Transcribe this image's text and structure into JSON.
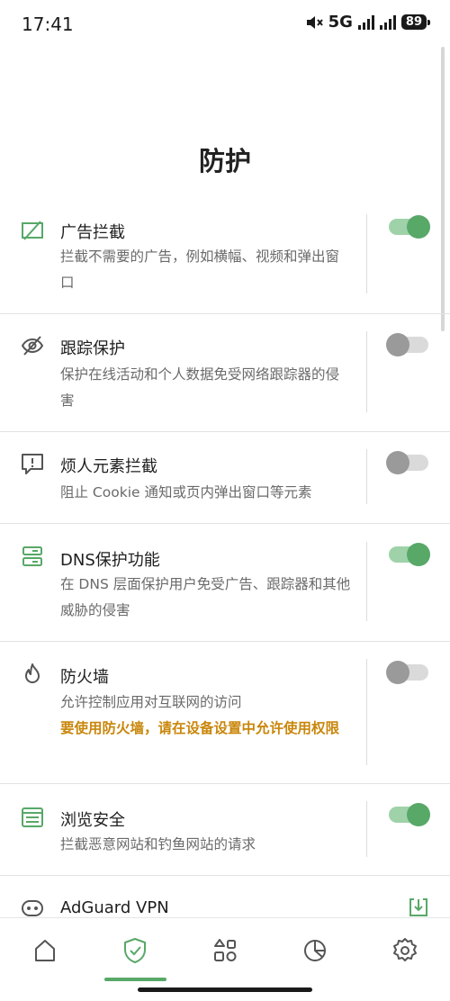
{
  "status_bar": {
    "time": "17:41",
    "network": "5G",
    "battery": "89"
  },
  "page": {
    "title": "防护"
  },
  "items": [
    {
      "title": "广告拦截",
      "description": "拦截不需要的广告，例如横幅、视频和弹出窗口",
      "enabled": true,
      "icon": "ad-block-icon"
    },
    {
      "title": "跟踪保护",
      "description": "保护在线活动和个人数据免受网络跟踪器的侵害",
      "enabled": false,
      "icon": "eye-slash-icon"
    },
    {
      "title": "烦人元素拦截",
      "description": "阻止 Cookie 通知或页内弹出窗口等元素",
      "enabled": false,
      "icon": "message-alert-icon"
    },
    {
      "title": "DNS保护功能",
      "description": "在 DNS 层面保护用户免受广告、跟踪器和其他威胁的侵害",
      "enabled": true,
      "icon": "server-icon"
    },
    {
      "title": "防火墙",
      "description": "允许控制应用对互联网的访问",
      "warning": "要使用防火墙，请在设备设置中允许使用权限",
      "enabled": false,
      "icon": "flame-icon"
    },
    {
      "title": "浏览安全",
      "description": "拦截恶意网站和钓鱼网站的请求",
      "enabled": true,
      "icon": "browser-window-icon"
    },
    {
      "title": "AdGuard VPN",
      "icon": "vpn-icon",
      "action_icon": "download-icon"
    }
  ],
  "bottom_nav": [
    {
      "name": "home",
      "icon": "home-icon"
    },
    {
      "name": "protection",
      "icon": "shield-check-icon",
      "active": true
    },
    {
      "name": "apps",
      "icon": "apps-grid-icon"
    },
    {
      "name": "statistics",
      "icon": "pie-chart-icon"
    },
    {
      "name": "settings",
      "icon": "gear-icon"
    }
  ],
  "colors": {
    "accent": "#58a868",
    "accent_light": "#9fd2a9",
    "warning": "#c9860a",
    "text_secondary": "#6a6a6a"
  }
}
